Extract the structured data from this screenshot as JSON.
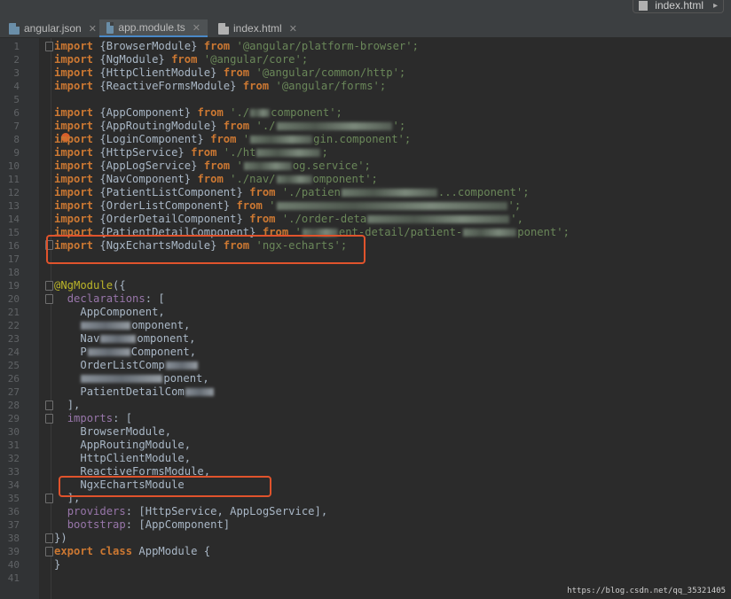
{
  "tabs": [
    {
      "name": "angular.json",
      "icon": "json-file-icon"
    },
    {
      "name": "app.module.ts",
      "icon": "ts-file-icon",
      "active": true
    },
    {
      "name": "index.html",
      "icon": "html-file-icon"
    }
  ],
  "nav_tab": {
    "label": "index.html"
  },
  "code": {
    "line1": {
      "kw": "import",
      "a": " {BrowserModule} ",
      "from": "from",
      "str": " '@angular/platform-browser';"
    },
    "line2": {
      "kw": "import",
      "a": " {NgModule} ",
      "from": "from",
      "str": " '@angular/core';"
    },
    "line3": {
      "kw": "import",
      "a": " {HttpClientModule} ",
      "from": "from",
      "str": " '@angular/common/http';"
    },
    "line4": {
      "kw": "import",
      "a": " {ReactiveFormsModule} ",
      "from": "from",
      "str": " '@angular/forms';"
    },
    "line6": {
      "kw": "import",
      "a": " {AppComponent} ",
      "from": "from",
      "str1": " './",
      "str2": "component';"
    },
    "line7": {
      "kw": "import",
      "a": " {AppRoutingModule} ",
      "from": "from",
      "str1": " './",
      "str2": "';"
    },
    "line8": {
      "kw": "import",
      "a": " {LoginComponent} ",
      "from": "from",
      "str1": " '",
      "str2": "gin.component';"
    },
    "line9": {
      "kw": "import",
      "a": " {HttpService} ",
      "from": "from",
      "str1": " './ht",
      "str2": ";"
    },
    "line10": {
      "kw": "import",
      "a": " {AppLogService} ",
      "from": "from",
      "str1": " '",
      "str2": "og.service';"
    },
    "line11": {
      "kw": "import",
      "a": " {NavComponent} ",
      "from": "from",
      "str1": " './nav/",
      "str2": "omponent';"
    },
    "line12": {
      "kw": "import",
      "a": " {PatientListComponent} ",
      "from": "from",
      "str1": " './patien",
      "str2": "...component';"
    },
    "line13": {
      "kw": "import",
      "a": " {OrderListComponent} ",
      "from": "from",
      "str1": " '",
      "str2": "';"
    },
    "line14": {
      "kw": "import",
      "a": " {OrderDetailComponent} ",
      "from": "from",
      "str1": " './order-deta",
      "str2": "',"
    },
    "line15": {
      "kw": "import",
      "a": " {PatientDetailComponent} ",
      "from": "from",
      "str1": " '",
      "str2": "ent-detail/patient-",
      "str3": "ponent';"
    },
    "line16": {
      "kw": "import",
      "a": " {NgxEchartsModule} ",
      "from": "from",
      "str": " 'ngx-echarts';"
    },
    "line19": {
      "dec": "@NgModule",
      "rest": "({"
    },
    "line20": {
      "prop": "declarations",
      "rest": ": ["
    },
    "line21": "AppComponent,",
    "line22": "omponent,",
    "line23": {
      "a": "Nav",
      "b": "omponent,"
    },
    "line24": {
      "a": "P",
      "b": "Component,"
    },
    "line25": {
      "a": "OrderListComp",
      "b": ""
    },
    "line26": {
      "a": "",
      "b": "ponent,"
    },
    "line27": {
      "a": "PatientDetailCom",
      "b": ""
    },
    "line28": "],",
    "line29": {
      "prop": "imports",
      "rest": ": ["
    },
    "line30": "BrowserModule,",
    "line31": "AppRoutingModule,",
    "line32": "HttpClientModule,",
    "line33": "ReactiveFormsModule,",
    "line34": "NgxEchartsModule",
    "line35": "],",
    "line36": {
      "prop": "providers",
      "rest": ": [HttpService, AppLogService],"
    },
    "line37": {
      "prop": "bootstrap",
      "rest": ": [AppComponent]"
    },
    "line38": "})",
    "line39": {
      "kw1": "export",
      "kw2": "class",
      "rest": " AppModule {"
    },
    "line40": "}"
  },
  "line_numbers": [
    "1",
    "2",
    "3",
    "4",
    "5",
    "6",
    "7",
    "8",
    "9",
    "10",
    "11",
    "12",
    "13",
    "14",
    "15",
    "16",
    "17",
    "18",
    "19",
    "20",
    "21",
    "22",
    "23",
    "24",
    "25",
    "26",
    "27",
    "28",
    "29",
    "30",
    "31",
    "32",
    "33",
    "34",
    "35",
    "36",
    "37",
    "38",
    "39",
    "40",
    "41"
  ],
  "watermark": "https://blog.csdn.net/qq_35321405",
  "colors": {
    "highlight": "#e0532c",
    "keyword": "#cc7832",
    "string": "#6a8759",
    "property": "#9876aa",
    "decorator": "#bbb529"
  }
}
